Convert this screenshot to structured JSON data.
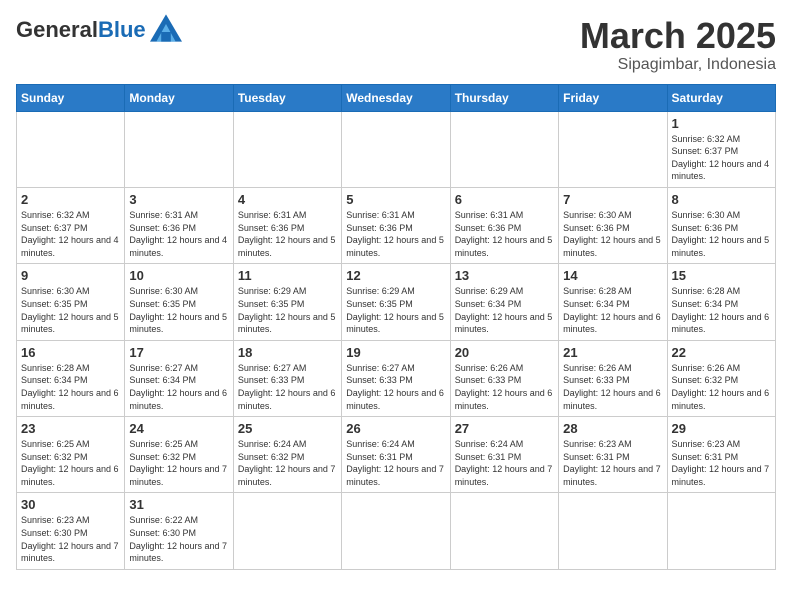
{
  "header": {
    "logo_general": "General",
    "logo_blue": "Blue",
    "title": "March 2025",
    "subtitle": "Sipagimbar, Indonesia"
  },
  "days_of_week": [
    "Sunday",
    "Monday",
    "Tuesday",
    "Wednesday",
    "Thursday",
    "Friday",
    "Saturday"
  ],
  "weeks": [
    [
      {
        "day": "",
        "info": ""
      },
      {
        "day": "",
        "info": ""
      },
      {
        "day": "",
        "info": ""
      },
      {
        "day": "",
        "info": ""
      },
      {
        "day": "",
        "info": ""
      },
      {
        "day": "",
        "info": ""
      },
      {
        "day": "1",
        "info": "Sunrise: 6:32 AM\nSunset: 6:37 PM\nDaylight: 12 hours and 4 minutes."
      }
    ],
    [
      {
        "day": "2",
        "info": "Sunrise: 6:32 AM\nSunset: 6:37 PM\nDaylight: 12 hours and 4 minutes."
      },
      {
        "day": "3",
        "info": "Sunrise: 6:31 AM\nSunset: 6:36 PM\nDaylight: 12 hours and 4 minutes."
      },
      {
        "day": "4",
        "info": "Sunrise: 6:31 AM\nSunset: 6:36 PM\nDaylight: 12 hours and 5 minutes."
      },
      {
        "day": "5",
        "info": "Sunrise: 6:31 AM\nSunset: 6:36 PM\nDaylight: 12 hours and 5 minutes."
      },
      {
        "day": "6",
        "info": "Sunrise: 6:31 AM\nSunset: 6:36 PM\nDaylight: 12 hours and 5 minutes."
      },
      {
        "day": "7",
        "info": "Sunrise: 6:30 AM\nSunset: 6:36 PM\nDaylight: 12 hours and 5 minutes."
      },
      {
        "day": "8",
        "info": "Sunrise: 6:30 AM\nSunset: 6:36 PM\nDaylight: 12 hours and 5 minutes."
      }
    ],
    [
      {
        "day": "9",
        "info": "Sunrise: 6:30 AM\nSunset: 6:35 PM\nDaylight: 12 hours and 5 minutes."
      },
      {
        "day": "10",
        "info": "Sunrise: 6:30 AM\nSunset: 6:35 PM\nDaylight: 12 hours and 5 minutes."
      },
      {
        "day": "11",
        "info": "Sunrise: 6:29 AM\nSunset: 6:35 PM\nDaylight: 12 hours and 5 minutes."
      },
      {
        "day": "12",
        "info": "Sunrise: 6:29 AM\nSunset: 6:35 PM\nDaylight: 12 hours and 5 minutes."
      },
      {
        "day": "13",
        "info": "Sunrise: 6:29 AM\nSunset: 6:34 PM\nDaylight: 12 hours and 5 minutes."
      },
      {
        "day": "14",
        "info": "Sunrise: 6:28 AM\nSunset: 6:34 PM\nDaylight: 12 hours and 6 minutes."
      },
      {
        "day": "15",
        "info": "Sunrise: 6:28 AM\nSunset: 6:34 PM\nDaylight: 12 hours and 6 minutes."
      }
    ],
    [
      {
        "day": "16",
        "info": "Sunrise: 6:28 AM\nSunset: 6:34 PM\nDaylight: 12 hours and 6 minutes."
      },
      {
        "day": "17",
        "info": "Sunrise: 6:27 AM\nSunset: 6:34 PM\nDaylight: 12 hours and 6 minutes."
      },
      {
        "day": "18",
        "info": "Sunrise: 6:27 AM\nSunset: 6:33 PM\nDaylight: 12 hours and 6 minutes."
      },
      {
        "day": "19",
        "info": "Sunrise: 6:27 AM\nSunset: 6:33 PM\nDaylight: 12 hours and 6 minutes."
      },
      {
        "day": "20",
        "info": "Sunrise: 6:26 AM\nSunset: 6:33 PM\nDaylight: 12 hours and 6 minutes."
      },
      {
        "day": "21",
        "info": "Sunrise: 6:26 AM\nSunset: 6:33 PM\nDaylight: 12 hours and 6 minutes."
      },
      {
        "day": "22",
        "info": "Sunrise: 6:26 AM\nSunset: 6:32 PM\nDaylight: 12 hours and 6 minutes."
      }
    ],
    [
      {
        "day": "23",
        "info": "Sunrise: 6:25 AM\nSunset: 6:32 PM\nDaylight: 12 hours and 6 minutes."
      },
      {
        "day": "24",
        "info": "Sunrise: 6:25 AM\nSunset: 6:32 PM\nDaylight: 12 hours and 7 minutes."
      },
      {
        "day": "25",
        "info": "Sunrise: 6:24 AM\nSunset: 6:32 PM\nDaylight: 12 hours and 7 minutes."
      },
      {
        "day": "26",
        "info": "Sunrise: 6:24 AM\nSunset: 6:31 PM\nDaylight: 12 hours and 7 minutes."
      },
      {
        "day": "27",
        "info": "Sunrise: 6:24 AM\nSunset: 6:31 PM\nDaylight: 12 hours and 7 minutes."
      },
      {
        "day": "28",
        "info": "Sunrise: 6:23 AM\nSunset: 6:31 PM\nDaylight: 12 hours and 7 minutes."
      },
      {
        "day": "29",
        "info": "Sunrise: 6:23 AM\nSunset: 6:31 PM\nDaylight: 12 hours and 7 minutes."
      }
    ],
    [
      {
        "day": "30",
        "info": "Sunrise: 6:23 AM\nSunset: 6:30 PM\nDaylight: 12 hours and 7 minutes."
      },
      {
        "day": "31",
        "info": "Sunrise: 6:22 AM\nSunset: 6:30 PM\nDaylight: 12 hours and 7 minutes."
      },
      {
        "day": "",
        "info": ""
      },
      {
        "day": "",
        "info": ""
      },
      {
        "day": "",
        "info": ""
      },
      {
        "day": "",
        "info": ""
      },
      {
        "day": "",
        "info": ""
      }
    ]
  ]
}
